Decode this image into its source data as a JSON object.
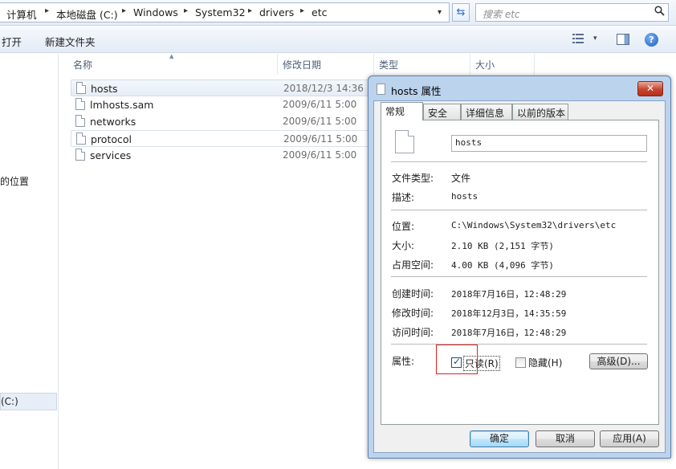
{
  "address": {
    "crumbs": [
      "计算机",
      "本地磁盘 (C:)",
      "Windows",
      "System32",
      "drivers",
      "etc"
    ],
    "separator": "▸",
    "dropdown": "▾",
    "refresh": "⇆"
  },
  "search": {
    "placeholder": "搜索 etc",
    "icon": "search-icon"
  },
  "toolbar": {
    "open_label": "打开",
    "new_folder_label": "新建文件夹",
    "view_icon": "view-options-icon",
    "pane_icon": "preview-pane-icon",
    "help": "?"
  },
  "nav": {
    "location_label": "的位置",
    "drive_label": "(C:)"
  },
  "columns": {
    "name": "名称",
    "modified": "修改日期",
    "type": "类型",
    "size": "大小"
  },
  "files": [
    {
      "name": "hosts",
      "date": "2018/12/3 14:36"
    },
    {
      "name": "lmhosts.sam",
      "date": "2009/6/11 5:00"
    },
    {
      "name": "networks",
      "date": "2009/6/11 5:00"
    },
    {
      "name": "protocol",
      "date": "2009/6/11 5:00"
    },
    {
      "name": "services",
      "date": "2009/6/11 5:00"
    }
  ],
  "dialog": {
    "title": "hosts 属性",
    "close": "✕",
    "tabs": [
      "常规",
      "安全",
      "详细信息",
      "以前的版本"
    ],
    "filename": "hosts",
    "file_type_label": "文件类型:",
    "file_type_value": "文件",
    "desc_label": "描述:",
    "desc_value": "hosts",
    "location_label": "位置:",
    "location_value": "C:\\Windows\\System32\\drivers\\etc",
    "size_label": "大小:",
    "size_value": "2.10 KB (2,151 字节)",
    "disk_size_label": "占用空间:",
    "disk_size_value": "4.00 KB (4,096 字节)",
    "created_label": "创建时间:",
    "created_value": "2018年7月16日，12:48:29",
    "modified_label": "修改时间:",
    "modified_value": "2018年12月3日，14:35:59",
    "accessed_label": "访问时间:",
    "accessed_value": "2018年7月16日，12:48:29",
    "attributes_label": "属性:",
    "readonly_label": "只读(R)",
    "readonly_checked": true,
    "hidden_label": "隐藏(H)",
    "hidden_checked": false,
    "advanced_label": "高级(D)...",
    "ok_label": "确定",
    "cancel_label": "取消",
    "apply_label": "应用(A)"
  }
}
